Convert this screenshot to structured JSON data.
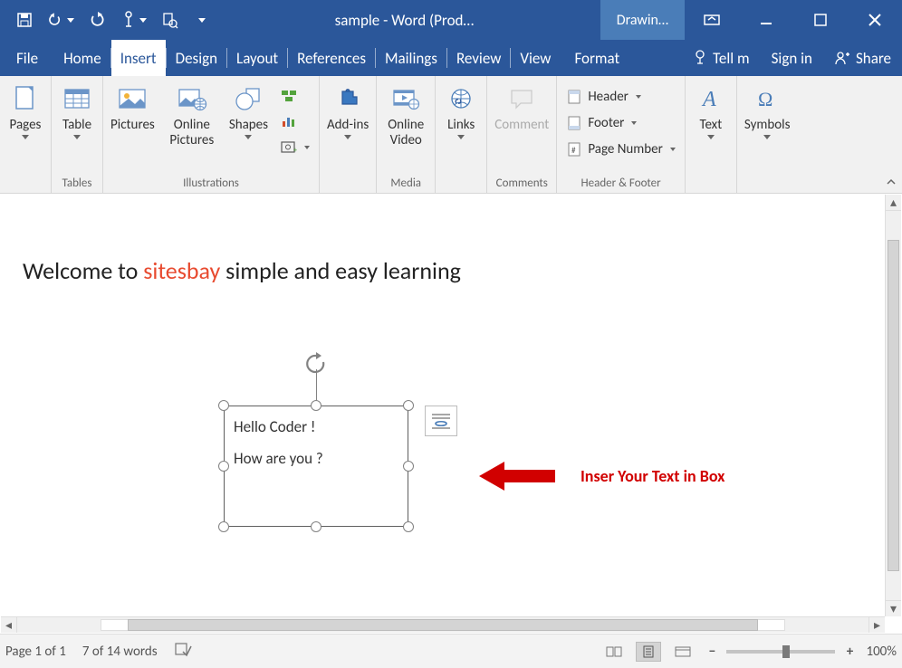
{
  "titlebar": {
    "title": "sample - Word (Prod…",
    "context_tab": "Drawin…"
  },
  "tabs": {
    "file": "File",
    "items": [
      "Home",
      "Insert",
      "Design",
      "Layout",
      "References",
      "Mailings",
      "Review",
      "View"
    ],
    "format": "Format",
    "active_index": 1,
    "tell_me": "Tell m",
    "sign_in": "Sign in",
    "share": "Share"
  },
  "ribbon": {
    "groups": {
      "pages": {
        "label": "",
        "btn": "Pages"
      },
      "tables": {
        "label": "Tables",
        "btn": "Table"
      },
      "illustrations": {
        "label": "Illustrations",
        "pictures": "Pictures",
        "online_pictures": "Online Pictures",
        "shapes": "Shapes"
      },
      "addins": {
        "btn": "Add-ins"
      },
      "media": {
        "label": "Media",
        "btn": "Online Video"
      },
      "links": {
        "btn": "Links"
      },
      "comments": {
        "label": "Comments",
        "btn": "Comment"
      },
      "header_footer": {
        "label": "Header & Footer",
        "header": "Header",
        "footer": "Footer",
        "page_number": "Page Number"
      },
      "text": {
        "btn": "Text"
      },
      "symbols": {
        "btn": "Symbols"
      }
    }
  },
  "document": {
    "heading_pre": "Welcome to ",
    "heading_brand": "sitesbay",
    "heading_post": " simple and easy learning",
    "textbox_line1": "Hello Coder !",
    "textbox_line2": "How are you ?",
    "callout": "Inser Your Text in Box"
  },
  "statusbar": {
    "page": "Page 1 of 1",
    "words": "7 of 14 words",
    "zoom": "100%"
  }
}
